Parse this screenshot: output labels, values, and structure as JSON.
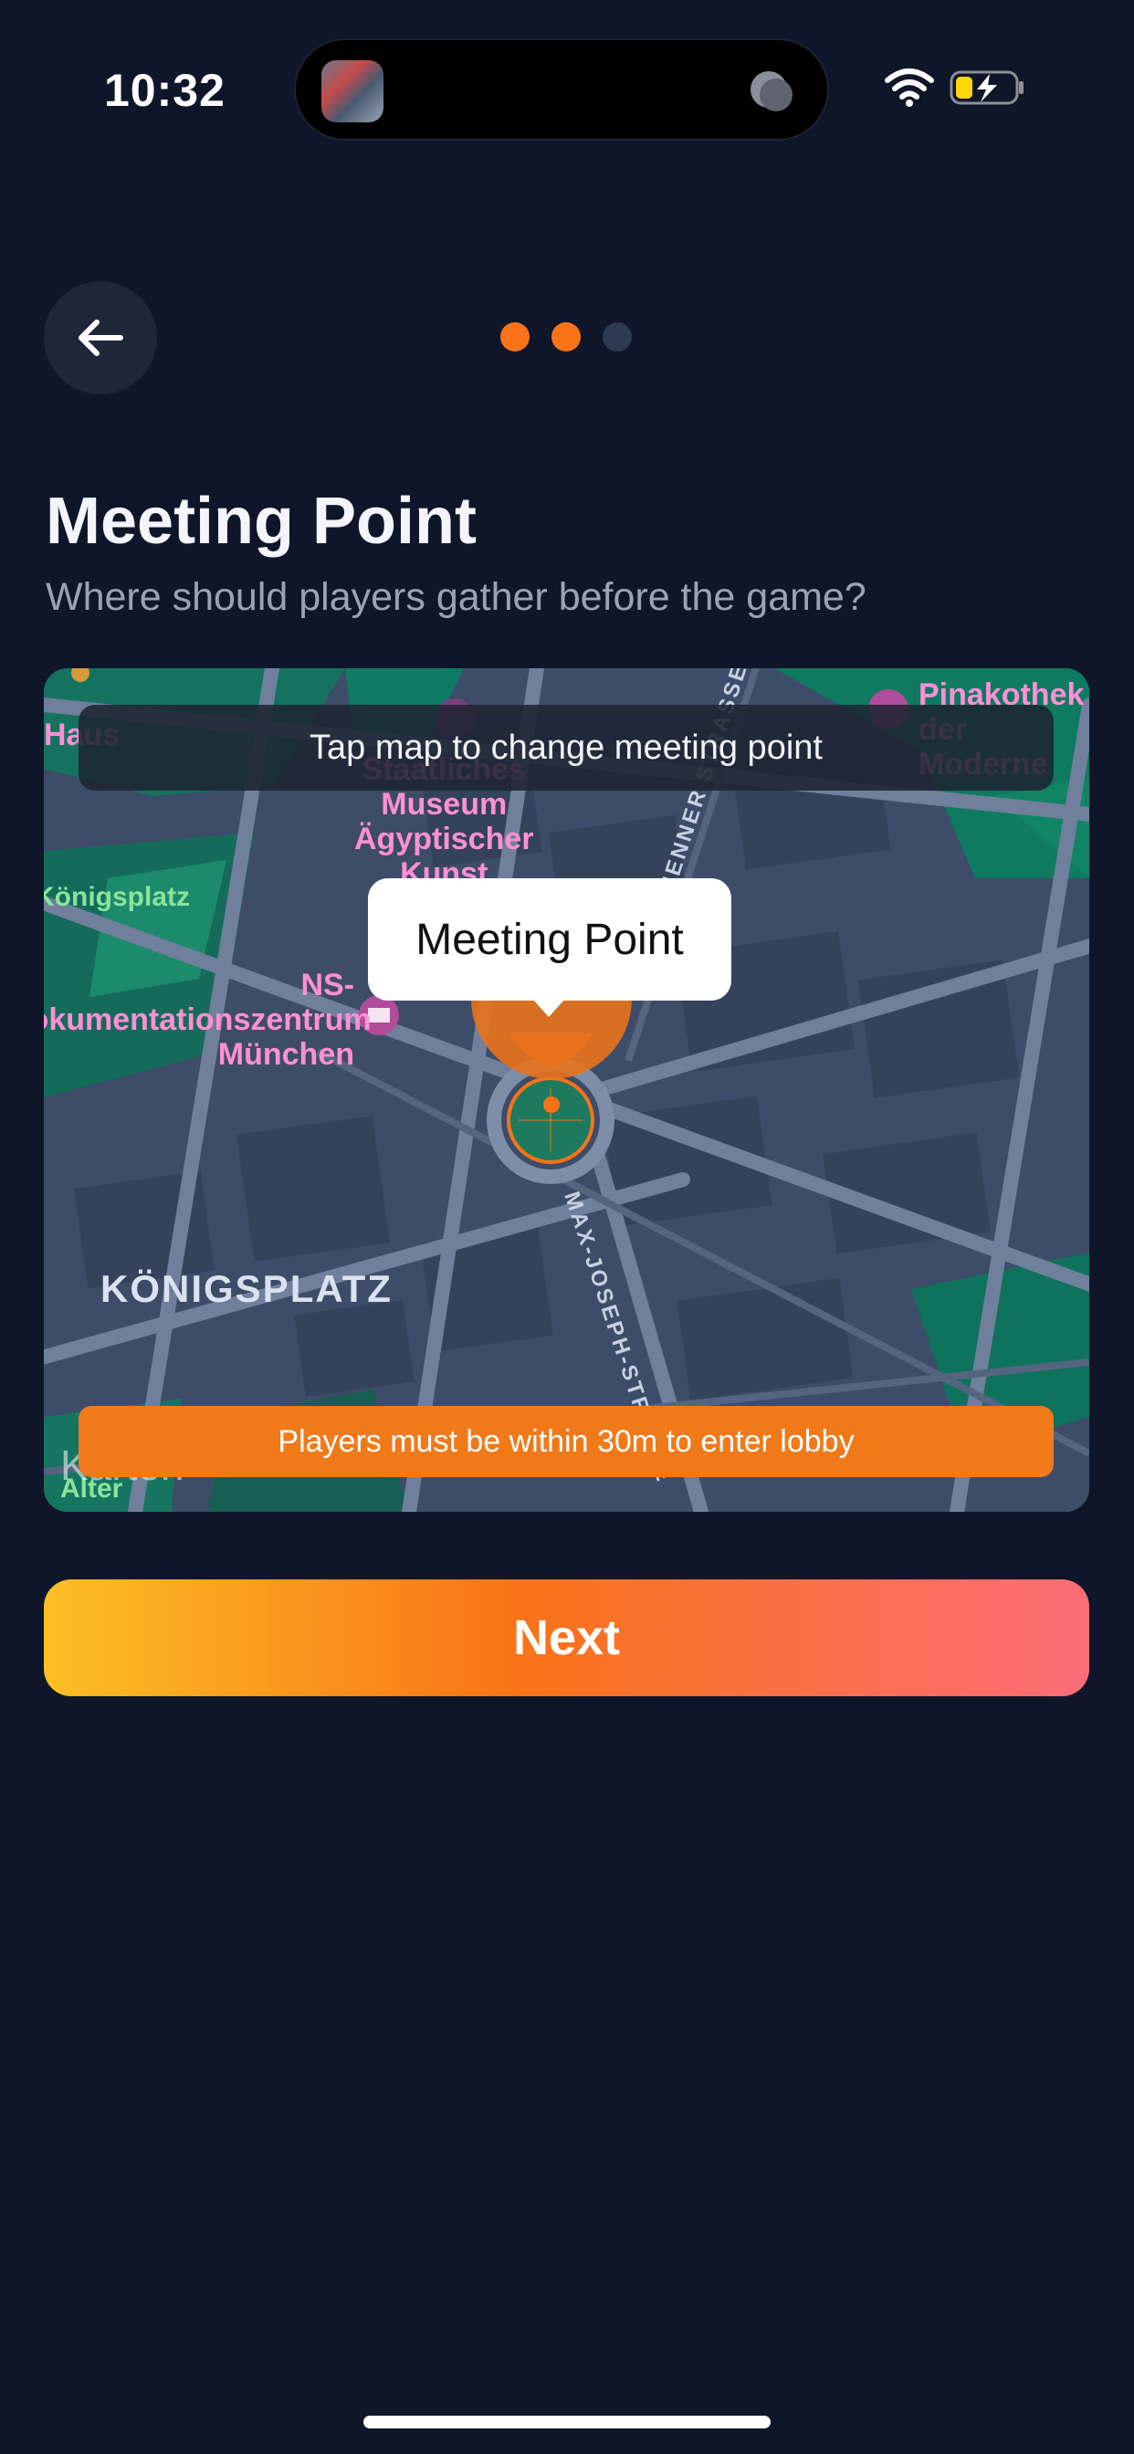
{
  "status_bar": {
    "time": "10:32",
    "icons": [
      "app-thumbnail-icon",
      "timer-icon",
      "wifi-icon",
      "battery-charging-icon"
    ]
  },
  "header": {
    "back_icon": "arrow-left-icon",
    "progress": {
      "total_steps": 3,
      "completed_steps": 2,
      "active_color": "#f97316",
      "inactive_color": "#2e3a52"
    }
  },
  "page": {
    "title": "Meeting Point",
    "subtitle": "Where should players gather before the game?"
  },
  "map": {
    "hint": "Tap map to change meeting point",
    "pin_label": "Meeting Point",
    "radius_notice": "Players must be within 30m to enter lobby",
    "attribution": "Karten",
    "labels": {
      "pinakothek": "Pinakothek\nder Moderne",
      "museum": "Staatliches\nMuseum\nÄgyptischer\nKunst",
      "ns_doku": "NS-\nDokumentationszentrum\nMünchen",
      "konigsplatz_small": "Königsplatz",
      "district": "KÖNIGSPLATZ",
      "street_max_joseph": "MAX-JOSEPH-STRASSE",
      "street_top": "BRIENNER STRASSE",
      "haus": "Haus",
      "alter": "Alter"
    }
  },
  "actions": {
    "next_label": "Next"
  },
  "colors": {
    "background": "#0f1629",
    "accent_orange": "#f97316",
    "gradient_start": "#fbbf24",
    "gradient_end": "#fb6d78"
  }
}
